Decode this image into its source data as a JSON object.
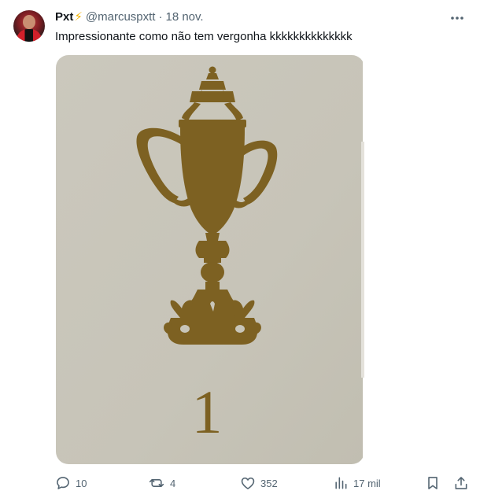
{
  "tweet": {
    "display_name": "Pxt",
    "name_emoji": "⚡",
    "handle": "@marcuspxtt",
    "separator": "·",
    "date": "18 nov.",
    "text": "Impressionante como não tem vergonha kkkkkkkkkkkkkk",
    "media": {
      "number": "1"
    },
    "actions": {
      "replies": "10",
      "reposts": "4",
      "likes": "352",
      "views": "17 mil"
    }
  },
  "colors": {
    "text_primary": "#0f1419",
    "text_secondary": "#536471",
    "trophy_gold": "#7d6122",
    "card_background": "#c9c6ba"
  },
  "icons": {
    "more": "more-icon",
    "reply": "reply-icon",
    "repost": "repost-icon",
    "like": "heart-icon",
    "views": "views-icon",
    "bookmark": "bookmark-icon",
    "share": "share-icon"
  }
}
